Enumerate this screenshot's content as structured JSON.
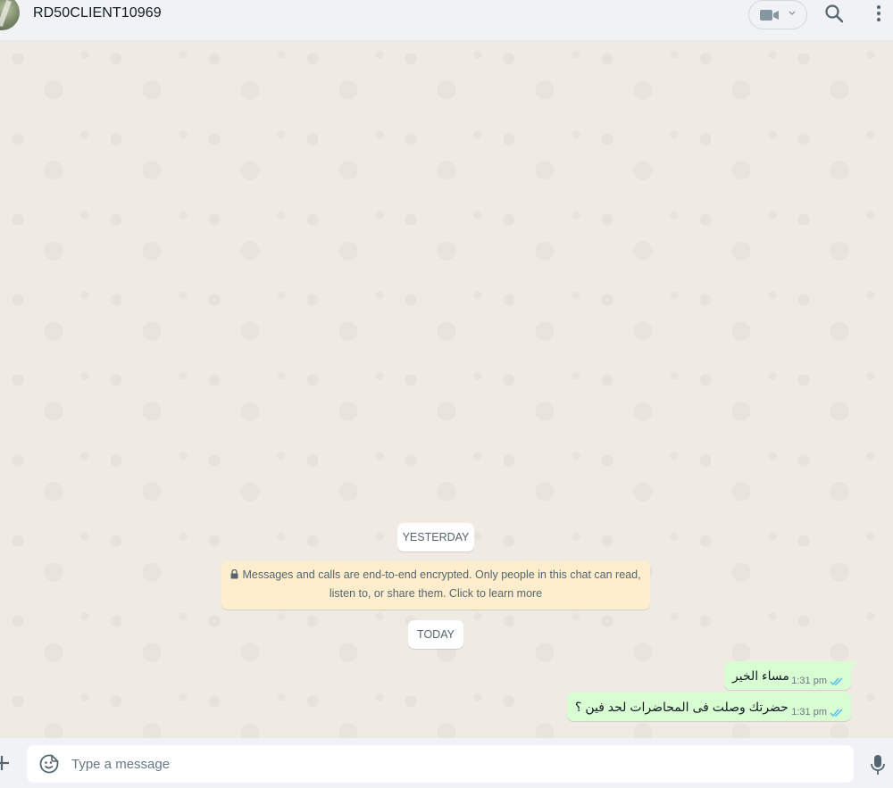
{
  "header": {
    "contact_name": "RD50CLIENT10969",
    "icons": [
      "avatar",
      "video-call-icon",
      "chevron-down-icon",
      "search-icon",
      "menu-icon"
    ]
  },
  "chat": {
    "date_chips": {
      "yesterday": "YESTERDAY",
      "today": "TODAY"
    },
    "encryption_notice": "Messages and calls are end-to-end encrypted. Only people in this chat can read, listen to, or share them. Click to learn more",
    "messages": [
      {
        "text": "مساء الخير",
        "time": "1:31 pm",
        "status": "read"
      },
      {
        "text": "حضرتك وصلت فى المحاضرات لحد فين ؟",
        "time": "1:31 pm",
        "status": "read"
      }
    ]
  },
  "footer": {
    "input_placeholder": "Type a message",
    "icons": [
      "plus-icon",
      "emoji-icon",
      "mic-icon"
    ]
  },
  "colors": {
    "outgoing_bubble": "#d9fdd3",
    "chat_background": "#efeae2",
    "header_background": "#f0f2f5",
    "notice_background": "#ffeecd",
    "read_tick": "#53bdeb"
  }
}
